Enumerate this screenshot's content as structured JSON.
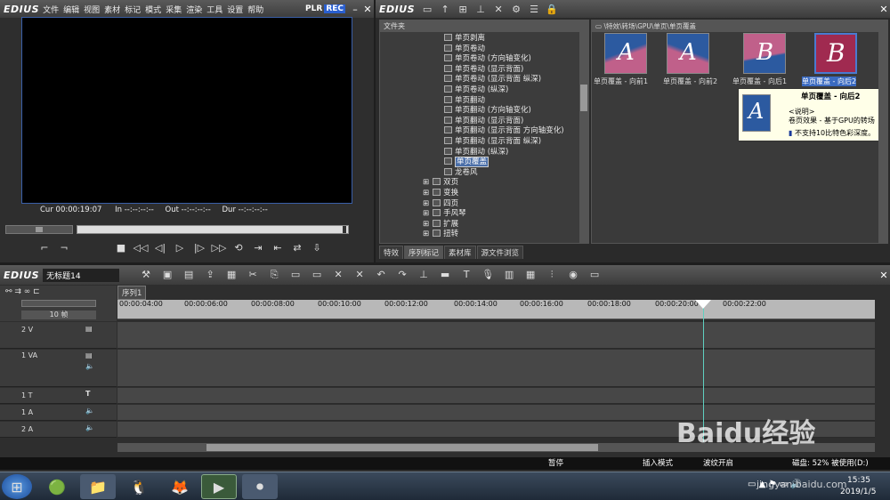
{
  "player": {
    "logo": "EDIUS",
    "menu": [
      "文件",
      "编辑",
      "视图",
      "素材",
      "标记",
      "模式",
      "采集",
      "渲染",
      "工具",
      "设置",
      "帮助"
    ],
    "plr": "PLR",
    "rec": "REC",
    "cur_label": "Cur",
    "cur_value": "00:00:19:07",
    "in_label": "In",
    "in_value": "--:--:--:--",
    "out_label": "Out",
    "out_value": "--:--:--:--",
    "dur_label": "Dur",
    "dur_value": "--:--:--:--"
  },
  "effects": {
    "logo": "EDIUS",
    "folder_header": "文件夹",
    "path": "\\特效\\转场\\GPU\\单页\\单页覆盖",
    "tree": [
      {
        "label": "单页剥离",
        "level": 1
      },
      {
        "label": "单页卷动",
        "level": 1
      },
      {
        "label": "单页卷动 (方向轴变化)",
        "level": 1
      },
      {
        "label": "单页卷动 (显示背面)",
        "level": 1
      },
      {
        "label": "单页卷动 (显示背面 纵深)",
        "level": 1
      },
      {
        "label": "单页卷动 (纵深)",
        "level": 1
      },
      {
        "label": "单页翻动",
        "level": 1
      },
      {
        "label": "单页翻动 (方向轴变化)",
        "level": 1
      },
      {
        "label": "单页翻动 (显示背面)",
        "level": 1
      },
      {
        "label": "单页翻动 (显示背面 方向轴变化)",
        "level": 1
      },
      {
        "label": "单页翻动 (显示背面 纵深)",
        "level": 1
      },
      {
        "label": "单页翻动 (纵深)",
        "level": 1
      },
      {
        "label": "单页覆盖",
        "level": 1,
        "selected": true
      },
      {
        "label": "龙卷风",
        "level": 1
      },
      {
        "label": "双页",
        "level": 0
      },
      {
        "label": "变换",
        "level": 0
      },
      {
        "label": "四页",
        "level": 0
      },
      {
        "label": "手风琴",
        "level": 0
      },
      {
        "label": "扩展",
        "level": 0
      },
      {
        "label": "扭转",
        "level": 0
      }
    ],
    "thumbs": [
      {
        "label": "单页覆盖 - 向前1"
      },
      {
        "label": "单页覆盖 - 向前2"
      },
      {
        "label": "单页覆盖 - 向后1"
      },
      {
        "label": "单页覆盖 - 向后2",
        "selected": true
      }
    ],
    "tooltip": {
      "title": "单页覆盖 - 向后2",
      "desc_header": "<说明>",
      "desc": "卷页效果 - 基于GPU的转场",
      "warn": "不支持10比特色彩深度。"
    },
    "tabs": [
      "特效",
      "序列标记",
      "素材库",
      "源文件浏览"
    ]
  },
  "timeline": {
    "logo": "EDIUS",
    "project": "无标题14",
    "sequence_tab": "序列1",
    "zoom": "10 帧",
    "ticks": [
      "00:00:04:00",
      "00:00:06:00",
      "00:00:08:00",
      "00:00:10:00",
      "00:00:12:00",
      "00:00:14:00",
      "00:00:16:00",
      "00:00:18:00",
      "00:00:20:00",
      "00:00:22:00"
    ],
    "tracks": [
      {
        "name": "2 V"
      },
      {
        "name": "1 VA"
      },
      {
        "name": "1 T"
      },
      {
        "name": "1 A"
      },
      {
        "name": "2 A"
      }
    ]
  },
  "status": {
    "pause": "暂停",
    "insert": "插入模式",
    "ripple": "波纹开启",
    "disk": "磁盘: 52% 被使用(D:)"
  },
  "taskbar": {
    "time": "15:35",
    "date": "2019/1/5"
  },
  "watermark": {
    "brand": "Baidu经验",
    "url": "jingyan.baidu.com"
  }
}
